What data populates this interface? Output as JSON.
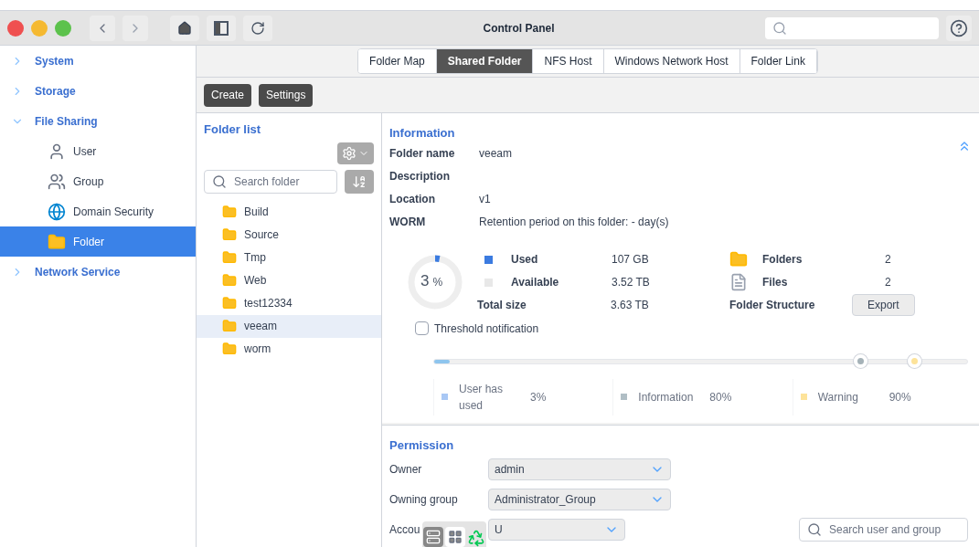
{
  "window": {
    "title": "Control Panel"
  },
  "sidebar": {
    "items": [
      {
        "label": "System",
        "expanded": false,
        "selected": false
      },
      {
        "label": "Storage",
        "expanded": false,
        "selected": false
      },
      {
        "label": "File Sharing",
        "expanded": true,
        "selected": false,
        "children": [
          {
            "label": "User",
            "kind": "user",
            "selected": false
          },
          {
            "label": "Group",
            "kind": "group",
            "selected": false
          },
          {
            "label": "Domain Security",
            "kind": "globe",
            "selected": false
          },
          {
            "label": "Folder",
            "kind": "folder",
            "selected": true
          }
        ]
      },
      {
        "label": "Network Service",
        "expanded": false,
        "selected": false
      }
    ]
  },
  "tabs": [
    {
      "label": "Folder Map",
      "selected": false
    },
    {
      "label": "Shared Folder",
      "selected": true
    },
    {
      "label": "NFS Host",
      "selected": false
    },
    {
      "label": "Windows Network Host",
      "selected": false
    },
    {
      "label": "Folder Link",
      "selected": false
    }
  ],
  "toolbar": [
    "Create",
    "Settings"
  ],
  "folder_list": {
    "title": "Folder list",
    "search_placeholder": "Search folder",
    "folders": [
      {
        "name": "Build",
        "selected": false
      },
      {
        "name": "Source",
        "selected": false
      },
      {
        "name": "Tmp",
        "selected": false
      },
      {
        "name": "Web",
        "selected": false
      },
      {
        "name": "test12334",
        "selected": false
      },
      {
        "name": "veeam",
        "selected": true
      },
      {
        "name": "worm",
        "selected": false
      }
    ]
  },
  "information": {
    "title": "Information",
    "fields": [
      {
        "label": "Folder name",
        "value": "veeam"
      },
      {
        "label": "Description"
      },
      {
        "label": "Location",
        "value": "v1"
      },
      {
        "label": "WORM",
        "value": "Retention period on this folder: - day(s)"
      }
    ],
    "usage": {
      "percent": "3",
      "unit": "%",
      "level": 0.03,
      "rows": [
        {
          "label": "Used",
          "value": "107 GB",
          "color": "#3b7be0"
        },
        {
          "label": "Available",
          "value": "3.52 TB",
          "color": "#e8e8e8"
        },
        {
          "label": "Total size",
          "value": "3.63 TB"
        }
      ]
    },
    "counts": [
      {
        "label": "Folders",
        "value": "2",
        "kind": "folder"
      },
      {
        "label": "Files",
        "value": "2",
        "kind": "file"
      },
      {
        "label": "Folder Structure",
        "button": "Export",
        "kind": "action"
      }
    ],
    "threshold": {
      "label": "Threshold notification",
      "checked": false,
      "bar": {
        "level": 0.03
      },
      "thumbs": [
        {
          "level": 0.8,
          "color": "#a5b2b8"
        },
        {
          "level": 0.9,
          "color": "#fde39a"
        }
      ],
      "legend": [
        {
          "label": "User has used",
          "value": "3%",
          "color": "#a9c8f5"
        },
        {
          "label": "Information",
          "value": "80%",
          "color": "#b0bec5"
        },
        {
          "label": "Warning",
          "value": "90%",
          "color": "#fde39a"
        }
      ]
    }
  },
  "permission": {
    "title": "Permission",
    "fields": [
      {
        "label": "Owner",
        "value": "admin"
      },
      {
        "label": "Owning group",
        "value": "Administrator_Group"
      },
      {
        "label": "Accou",
        "value": "U"
      }
    ],
    "search_placeholder": "Search user and group"
  }
}
